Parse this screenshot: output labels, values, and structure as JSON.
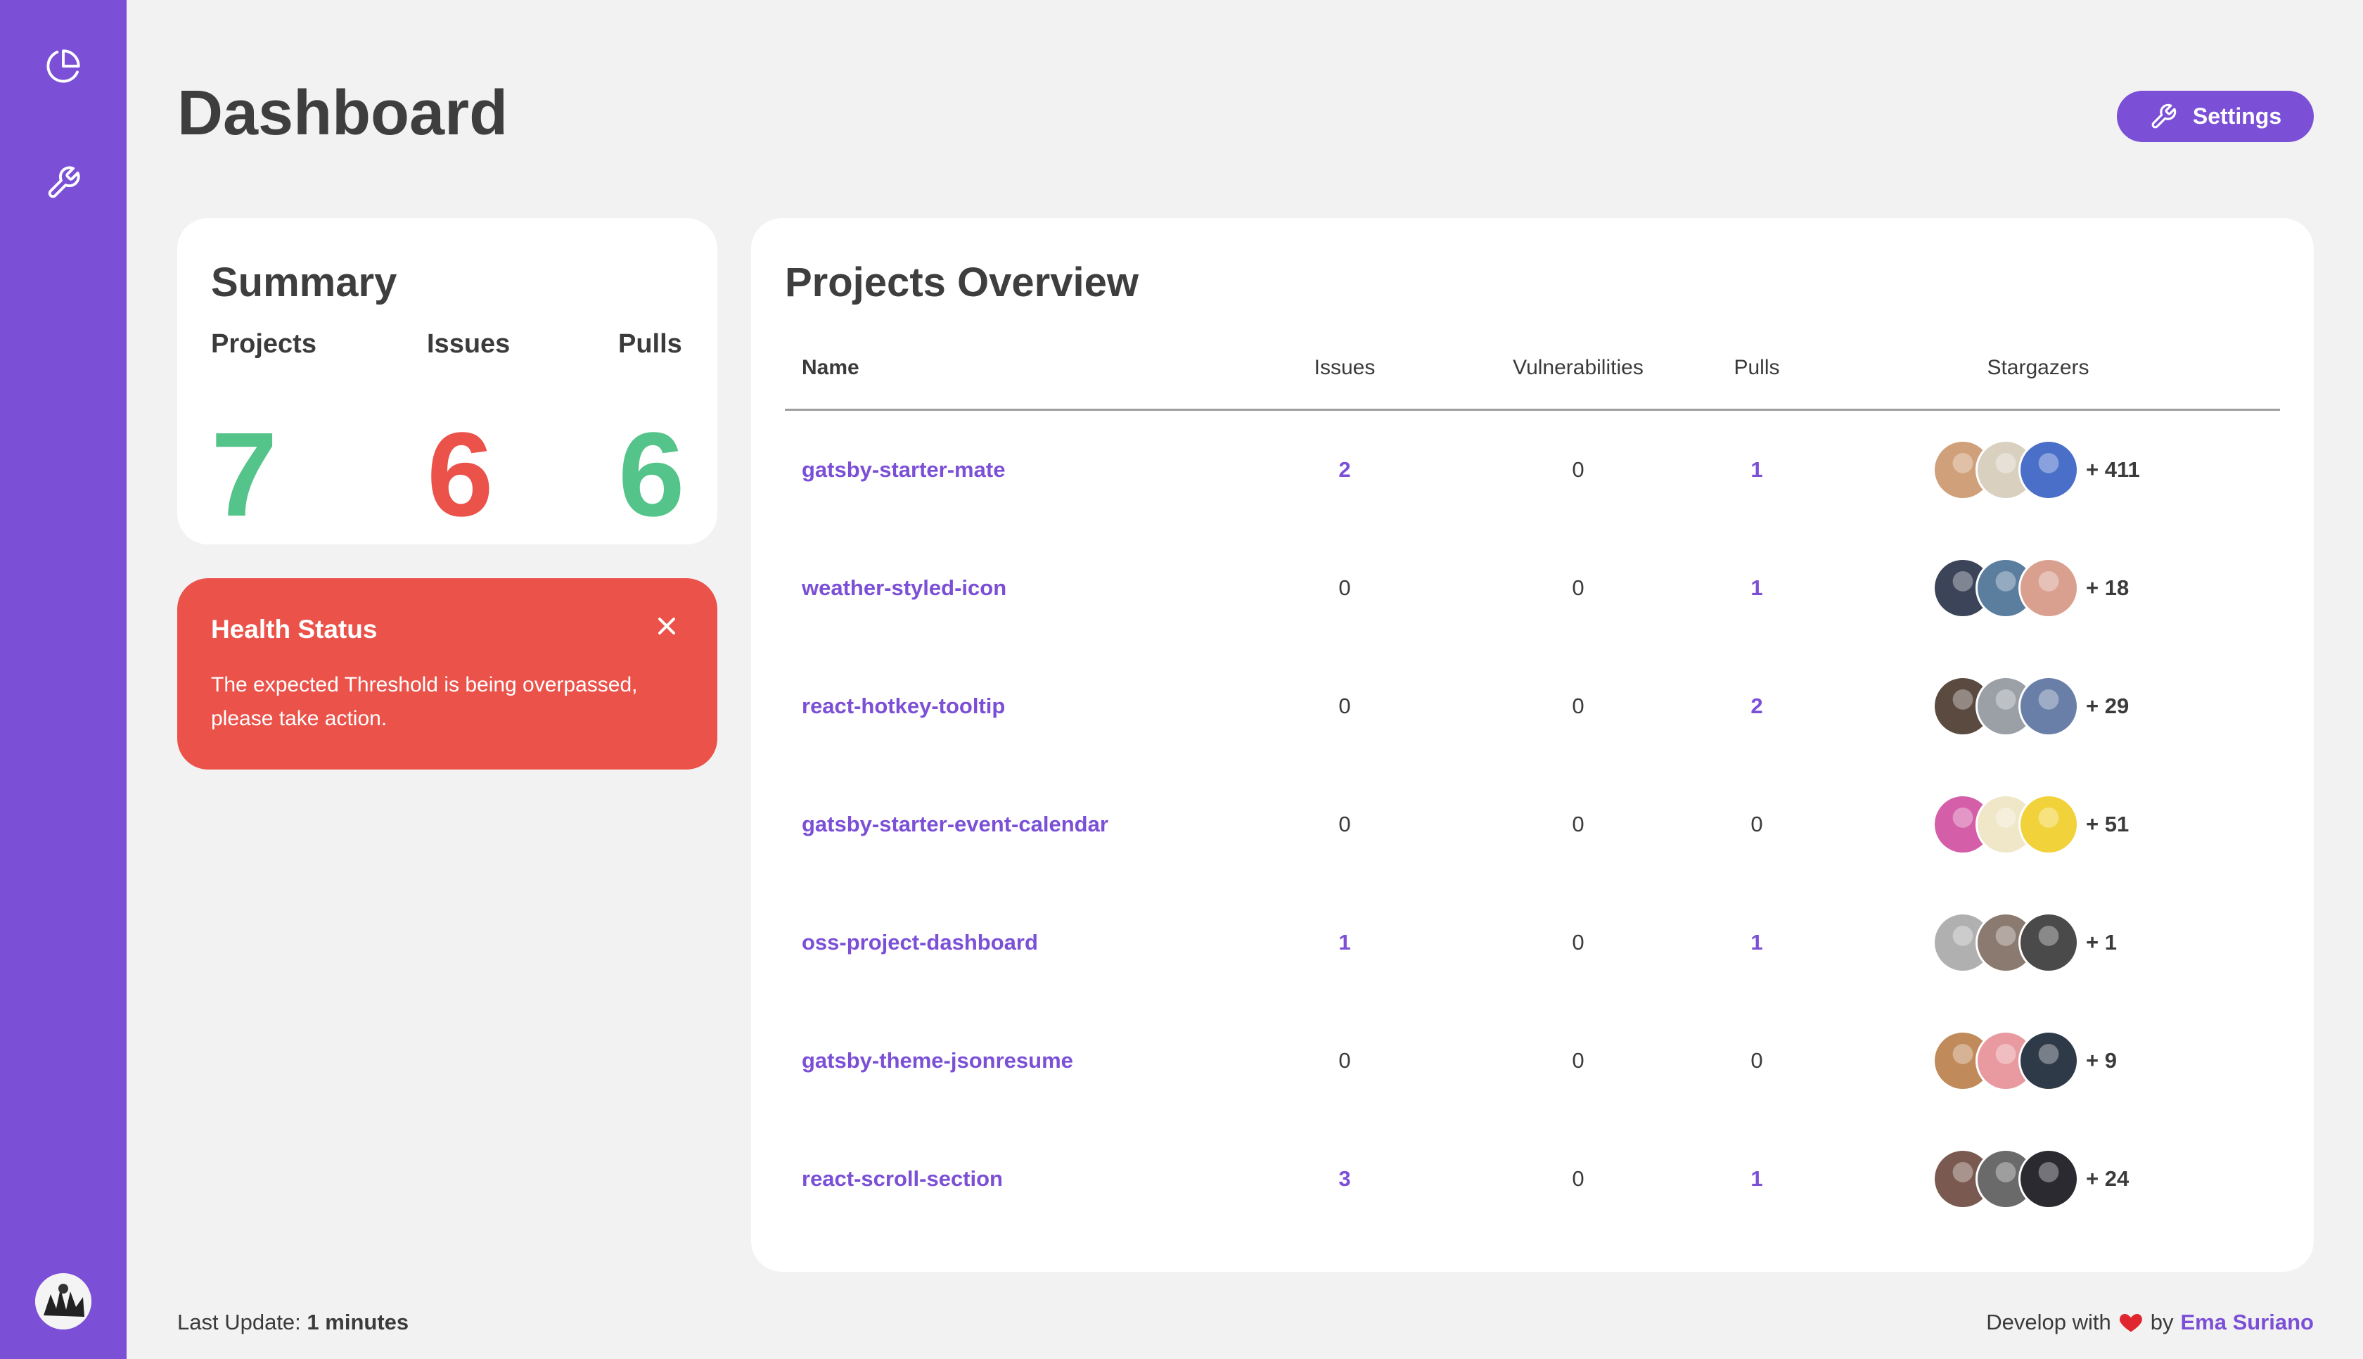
{
  "sidebar": {
    "items": [
      {
        "icon": "pie-chart-icon"
      },
      {
        "icon": "wrench-icon"
      }
    ],
    "avatar": "user-avatar"
  },
  "header": {
    "title": "Dashboard",
    "settings_label": "Settings"
  },
  "summary": {
    "title": "Summary",
    "stats": [
      {
        "label": "Projects",
        "value": "7",
        "color": "#55c48a"
      },
      {
        "label": "Issues",
        "value": "6",
        "color": "#ea524a"
      },
      {
        "label": "Pulls",
        "value": "6",
        "color": "#55c48a"
      }
    ]
  },
  "health": {
    "title": "Health Status",
    "message": "The expected Threshold is being overpassed, please take action.",
    "color": "#ea524a"
  },
  "projects": {
    "title": "Projects Overview",
    "columns": [
      "Name",
      "Issues",
      "Vulnerabilities",
      "Pulls",
      "Stargazers"
    ],
    "rows": [
      {
        "name": "gatsby-starter-mate",
        "issues": "2",
        "vulnerabilities": "0",
        "pulls": "1",
        "stargazers": "+ 411",
        "avatars": [
          "#cfa07a",
          "#d9d0c0",
          "#4a6fc9"
        ]
      },
      {
        "name": "weather-styled-icon",
        "issues": "0",
        "vulnerabilities": "0",
        "pulls": "1",
        "stargazers": "+ 18",
        "avatars": [
          "#3b4458",
          "#5b7d9e",
          "#d9a090"
        ]
      },
      {
        "name": "react-hotkey-tooltip",
        "issues": "0",
        "vulnerabilities": "0",
        "pulls": "2",
        "stargazers": "+ 29",
        "avatars": [
          "#5a4a40",
          "#9aa0a6",
          "#6a7fa8"
        ]
      },
      {
        "name": "gatsby-starter-event-calendar",
        "issues": "0",
        "vulnerabilities": "0",
        "pulls": "0",
        "stargazers": "+ 51",
        "avatars": [
          "#d45fa8",
          "#f0e6c8",
          "#f2d23a"
        ]
      },
      {
        "name": "oss-project-dashboard",
        "issues": "1",
        "vulnerabilities": "0",
        "pulls": "1",
        "stargazers": "+ 1",
        "avatars": [
          "#b0b0b0",
          "#8a7a70",
          "#4a4a4a"
        ]
      },
      {
        "name": "gatsby-theme-jsonresume",
        "issues": "0",
        "vulnerabilities": "0",
        "pulls": "0",
        "stargazers": "+ 9",
        "avatars": [
          "#c08a5a",
          "#e89aa0",
          "#2f3a48"
        ]
      },
      {
        "name": "react-scroll-section",
        "issues": "3",
        "vulnerabilities": "0",
        "pulls": "1",
        "stargazers": "+ 24",
        "avatars": [
          "#7a5a50",
          "#6a6a6a",
          "#2a2a30"
        ]
      }
    ]
  },
  "footer": {
    "last_update_label": "Last Update:",
    "last_update_value": "1 minutes",
    "develop_text": "Develop with",
    "by_text": "by",
    "author": "Ema Suriano"
  },
  "colors": {
    "accent": "#7b4fd6",
    "green": "#55c48a",
    "red": "#ea524a",
    "background": "#f2f2f2"
  }
}
